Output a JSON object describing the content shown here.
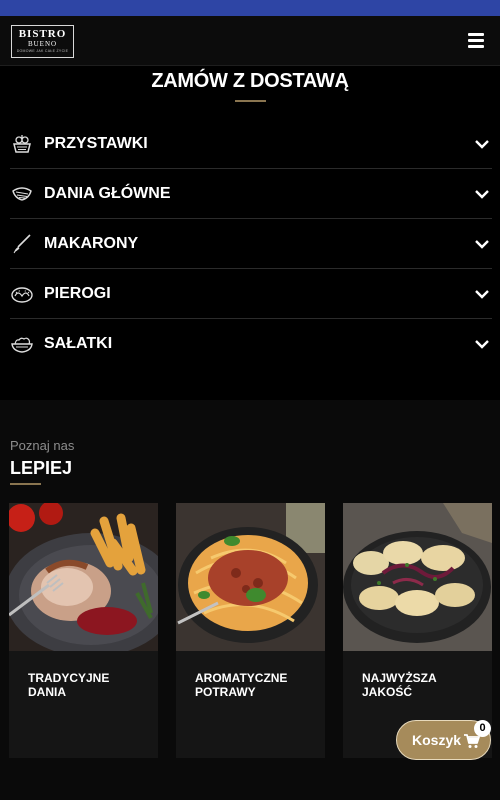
{
  "header": {
    "logo": {
      "name": "BISTRO",
      "sub": "BUENO",
      "tagline": "DOMOWE JAK CAŁE ŻYCIE"
    },
    "menu_icon": "hamburger-menu-icon"
  },
  "menu_section": {
    "title": "ZAMÓW Z DOSTAWĄ",
    "categories": [
      {
        "label": "PRZYSTAWKI",
        "icon": "appetizer-icon"
      },
      {
        "label": "DANIA GŁÓWNE",
        "icon": "main-dish-icon"
      },
      {
        "label": "MAKARONY",
        "icon": "pasta-icon"
      },
      {
        "label": "PIEROGI",
        "icon": "dumplings-icon"
      },
      {
        "label": "SAŁATKI",
        "icon": "salad-icon"
      }
    ]
  },
  "about": {
    "pretitle": "Poznaj nas",
    "title": "LEPIEJ",
    "cards": [
      {
        "caption": "TRADYCYJNE DANIA",
        "image": "meat-with-fries-photo"
      },
      {
        "caption": "AROMATYCZNE POTRAWY",
        "image": "spaghetti-bolognese-photo"
      },
      {
        "caption": "NAJWYŻSZA JAKOŚĆ",
        "image": "pierogi-photo"
      }
    ]
  },
  "cart": {
    "label": "Koszyk",
    "count": "0"
  },
  "colors": {
    "status_bar": "#2e45a5",
    "accent_gold": "#8a7550",
    "cart_button": "#a68b5b"
  }
}
